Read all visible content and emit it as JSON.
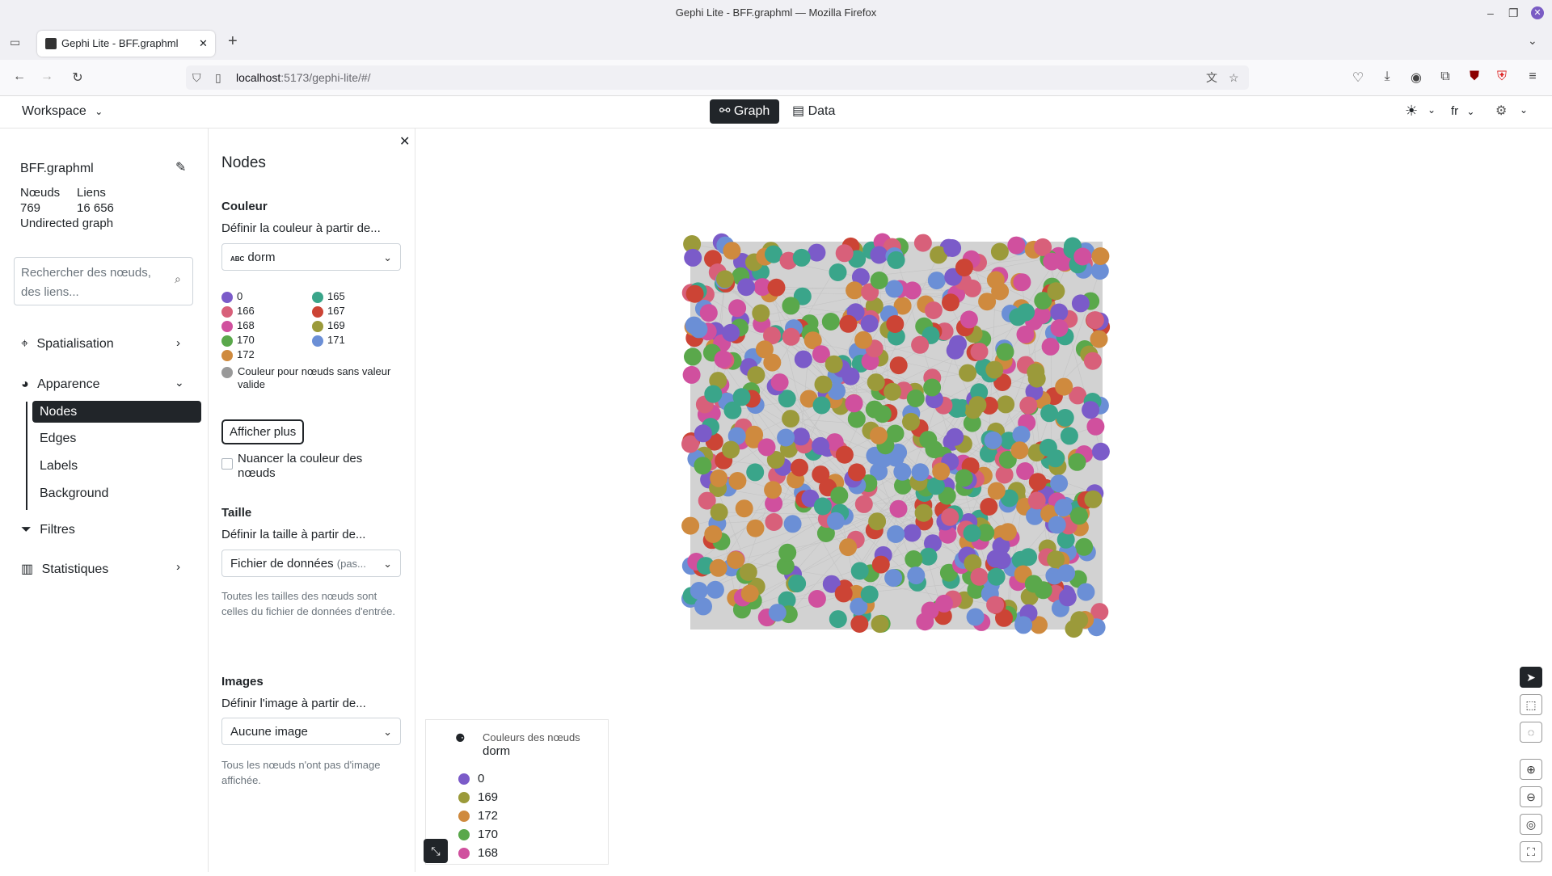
{
  "browser": {
    "window_title": "Gephi Lite - BFF.graphml — Mozilla Firefox",
    "tab_title": "Gephi Lite - BFF.graphml",
    "url_host": "localhost",
    "url_path": ":5173/gephi-lite/#/"
  },
  "header": {
    "workspace": "Workspace",
    "tab_graph": "Graph",
    "tab_data": "Data",
    "lang": "fr"
  },
  "leftnav": {
    "filename": "BFF.graphml",
    "nodes_label": "Nœuds",
    "edges_label": "Liens",
    "nodes_count": "769",
    "edges_count": "16 656",
    "graph_type": "Undirected graph",
    "search_placeholder": "Rechercher des nœuds, des liens...",
    "spatialisation": "Spatialisation",
    "appearance": "Apparence",
    "sub_items": [
      "Nodes",
      "Edges",
      "Labels",
      "Background"
    ],
    "filters": "Filtres",
    "statistics": "Statistiques"
  },
  "panel": {
    "title": "Nodes",
    "color_heading": "Couleur",
    "color_prompt": "Définir la couleur à partir de...",
    "color_type_badge": "ABC",
    "color_attribute": "dorm",
    "legend": [
      {
        "label": "0",
        "color": "#7b5bc9"
      },
      {
        "label": "165",
        "color": "#3aa58a"
      },
      {
        "label": "166",
        "color": "#d8607a"
      },
      {
        "label": "167",
        "color": "#cc4435"
      },
      {
        "label": "168",
        "color": "#d0509e"
      },
      {
        "label": "169",
        "color": "#9b9a3a"
      },
      {
        "label": "170",
        "color": "#5aa84b"
      },
      {
        "label": "171",
        "color": "#6b8fd6"
      },
      {
        "label": "172",
        "color": "#cf8a3e"
      }
    ],
    "default_color_label": "Couleur pour nœuds sans valeur valide",
    "default_color": "#999999",
    "show_more": "Afficher plus",
    "shade_label": "Nuancer la couleur des nœuds",
    "size_heading": "Taille",
    "size_prompt": "Définir la taille à partir de...",
    "size_value": "Fichier de données",
    "size_value_suffix": "(pas...",
    "size_note": "Toutes les tailles des nœuds sont celles du fichier de données d'entrée.",
    "images_heading": "Images",
    "images_prompt": "Définir l'image à partir de...",
    "images_value": "Aucune image",
    "images_note": "Tous les nœuds n'ont pas d'image affichée."
  },
  "graph_legend": {
    "title": "Couleurs des nœuds",
    "attribute": "dorm",
    "items": [
      {
        "label": "0",
        "color": "#7b5bc9"
      },
      {
        "label": "169",
        "color": "#9b9a3a"
      },
      {
        "label": "172",
        "color": "#cf8a3e"
      },
      {
        "label": "170",
        "color": "#5aa84b"
      },
      {
        "label": "168",
        "color": "#d0509e"
      }
    ]
  },
  "colors": {
    "accent": "#212529",
    "edge": "#d2d2d2"
  }
}
